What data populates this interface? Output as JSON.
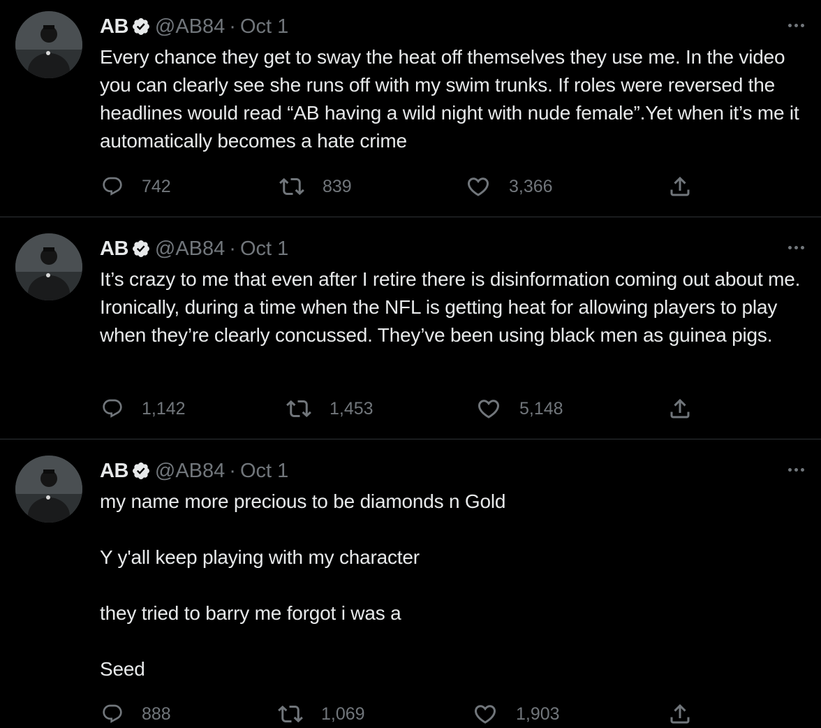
{
  "colors": {
    "background": "#000000",
    "text_primary": "#e7e9ea",
    "text_secondary": "#71767b",
    "divider": "#2f3336",
    "verified_badge": "#e7e9ea"
  },
  "icons": {
    "reply": "reply-icon",
    "retweet": "retweet-icon",
    "like": "heart-icon",
    "share": "share-icon",
    "more": "more-icon",
    "verified": "verified-badge-icon"
  },
  "tweets": [
    {
      "name": "AB",
      "handle": "@AB84",
      "separator": "·",
      "date": "Oct 1",
      "text": "Every chance they get to sway the heat off themselves they use me. In the video you can clearly see she runs off with my swim trunks. If roles were reversed the headlines would read “AB having a wild night with nude female”.Yet when it’s me it automatically becomes a hate crime",
      "replies": "742",
      "retweets": "839",
      "likes": "3,366"
    },
    {
      "name": "AB",
      "handle": "@AB84",
      "separator": "·",
      "date": "Oct 1",
      "text": "It’s crazy to me that even after I retire there is disinformation coming out about me. Ironically, during a time when the NFL is getting heat for allowing players to play when they’re clearly concussed. They’ve been using black men as guinea pigs.",
      "replies": "1,142",
      "retweets": "1,453",
      "likes": "5,148"
    },
    {
      "name": "AB",
      "handle": "@AB84",
      "separator": "·",
      "date": "Oct 1",
      "text": "my name more precious to be diamonds n Gold\n\nY y'all keep playing with my character\n\nthey tried to barry me forgot i was a\n\nSeed",
      "replies": "888",
      "retweets": "1,069",
      "likes": "1,903"
    }
  ]
}
